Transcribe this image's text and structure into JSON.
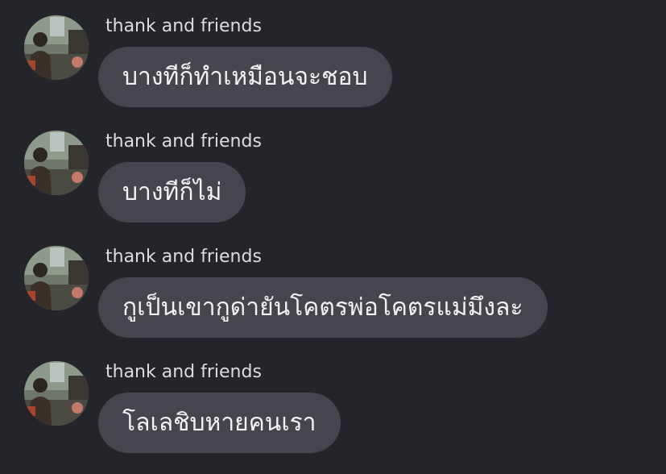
{
  "messages": [
    {
      "sender": "thank and friends",
      "text": "บางทีก็ทำเหมือนจะชอบ",
      "avatar_icon": "profile-photo-avatar"
    },
    {
      "sender": "thank and friends",
      "text": "บางทีก็ไม่",
      "avatar_icon": "profile-photo-avatar"
    },
    {
      "sender": "thank and friends",
      "text": "กูเป็นเขากูด่ายันโคตรพ่อโคตรแม่มึงละ",
      "avatar_icon": "profile-photo-avatar"
    },
    {
      "sender": "thank and friends",
      "text": "โลเลชิบหายคนเรา",
      "avatar_icon": "profile-photo-avatar"
    }
  ],
  "colors": {
    "background": "#24252b",
    "bubble": "#45464d",
    "text": "#f3f3f5",
    "sender": "#dcdde0"
  }
}
